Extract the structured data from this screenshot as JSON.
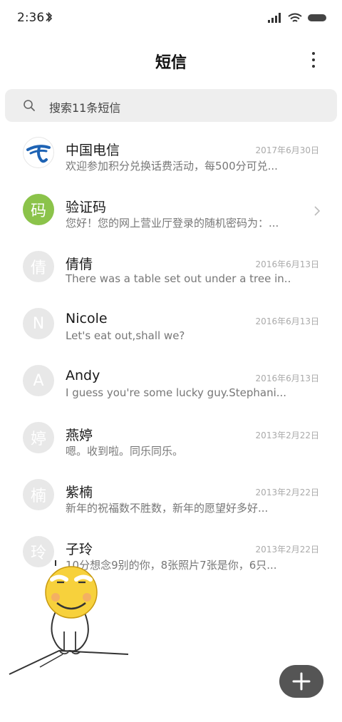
{
  "status": {
    "time": "2:36",
    "icons": [
      "bluetooth-icon",
      "signal-icon",
      "wifi-icon",
      "battery-icon"
    ]
  },
  "header": {
    "title": "短信",
    "menu_icon": "more-vertical-icon"
  },
  "search": {
    "placeholder": "搜索11条短信",
    "icon": "search-icon"
  },
  "colors": {
    "avatar_green": "#8bc34a",
    "avatar_grey": "#e8e8e8",
    "fab": "#555555"
  },
  "conversations": [
    {
      "name": "中国电信",
      "preview": "欢迎参加积分兑换话费活动，每500分可兑...",
      "date": "2017年6月30日",
      "avatar": "china-telecom-logo"
    },
    {
      "name": "验证码",
      "preview": "您好！您的网上营业厅登录的随机密码为：...",
      "date": "",
      "avatar": "码"
    },
    {
      "name": "倩倩",
      "preview": "There was a table set out under a tree in...",
      "date": "2016年6月13日",
      "avatar": "倩"
    },
    {
      "name": "Nicole",
      "preview": "Let's eat out,shall we?",
      "date": "2016年6月13日",
      "avatar": "N"
    },
    {
      "name": "Andy",
      "preview": "I guess you're some lucky guy.Stephani...",
      "date": "2016年6月13日",
      "avatar": "A"
    },
    {
      "name": "燕婷",
      "preview": "嗯。收到啦。同乐同乐。",
      "date": "2013年2月22日",
      "avatar": "婷"
    },
    {
      "name": "紫楠",
      "preview": "新年的祝福数不胜数，新年的愿望好多好...",
      "date": "2013年2月22日",
      "avatar": "楠"
    },
    {
      "name": "子玲",
      "preview": "10分想念9别的你，8张照片7张是你，6只...",
      "date": "2013年2月22日",
      "avatar": "玲"
    }
  ],
  "fab": {
    "icon": "plus-icon"
  }
}
